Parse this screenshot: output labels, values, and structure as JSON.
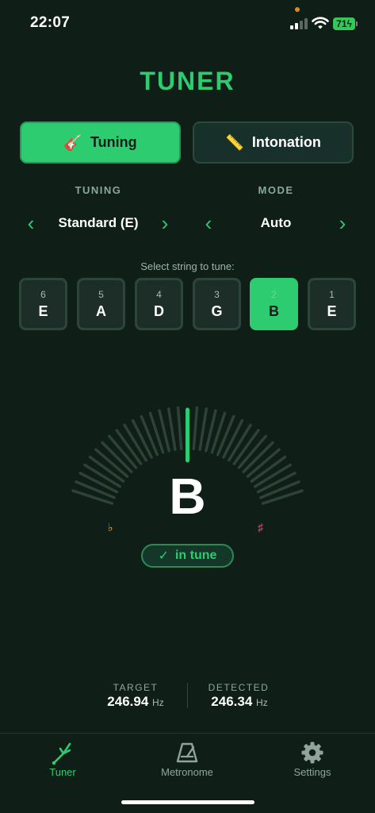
{
  "status_bar": {
    "time": "22:07",
    "battery": "71"
  },
  "header": {
    "title": "TUNER"
  },
  "mode_tabs": [
    {
      "label": "Tuning",
      "icon": "guitar-icon",
      "emoji": "🎸",
      "active": true
    },
    {
      "label": "Intonation",
      "icon": "ruler-icon",
      "emoji": "📏",
      "active": false
    }
  ],
  "selectors": {
    "tuning": {
      "label": "TUNING",
      "value": "Standard (E)"
    },
    "mode": {
      "label": "MODE",
      "value": "Auto"
    }
  },
  "strings": {
    "prompt": "Select string to tune:",
    "items": [
      {
        "number": "6",
        "note": "E"
      },
      {
        "number": "5",
        "note": "A"
      },
      {
        "number": "4",
        "note": "D"
      },
      {
        "number": "3",
        "note": "G"
      },
      {
        "number": "2",
        "note": "B"
      },
      {
        "number": "1",
        "note": "E"
      }
    ],
    "selected_index": 4
  },
  "meter": {
    "note": "B",
    "flat_symbol": "♭",
    "sharp_symbol": "♯",
    "status": "in tune",
    "status_icon": "✓",
    "needle_cents": 0
  },
  "frequency": {
    "target_label": "TARGET",
    "target_value": "246.94",
    "detected_label": "DETECTED",
    "detected_value": "246.34",
    "unit": "Hz"
  },
  "nav": [
    {
      "label": "Tuner",
      "icon": "tuning-fork-icon",
      "active": true
    },
    {
      "label": "Metronome",
      "icon": "metronome-icon",
      "active": false
    },
    {
      "label": "Settings",
      "icon": "gear-icon",
      "active": false
    }
  ],
  "colors": {
    "accent": "#2ecc71",
    "background": "#0f1f18",
    "flat": "#e6a23c",
    "sharp": "#e0466a"
  }
}
